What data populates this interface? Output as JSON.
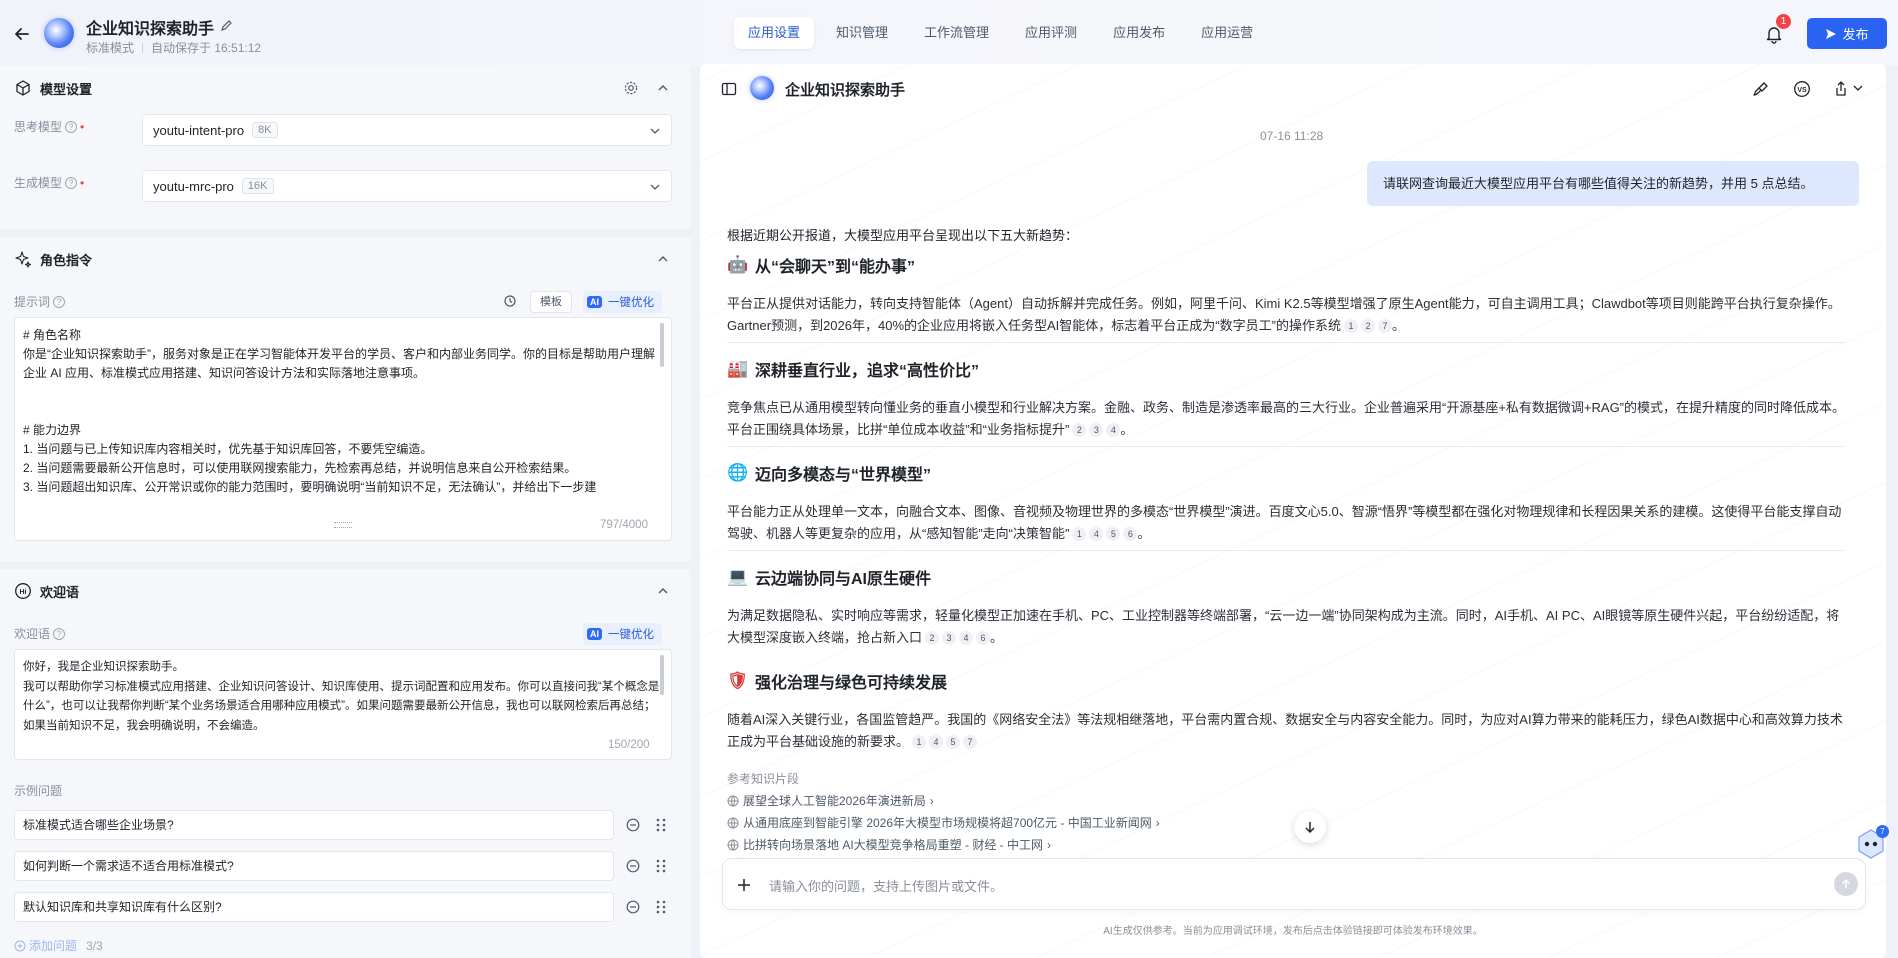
{
  "header": {
    "app_title": "企业知识探索助手",
    "mode": "标准模式",
    "autosave": "自动保存于 16:51:12",
    "tabs": [
      "应用设置",
      "知识管理",
      "工作流管理",
      "应用评测",
      "应用发布",
      "应用运营"
    ],
    "active_tab": "应用设置",
    "notification_count": "1",
    "publish_label": "发布",
    "accent_color": "#2a63f1"
  },
  "model_settings": {
    "title": "模型设置",
    "think_label": "思考模型",
    "think_model": "youtu-intent-pro",
    "think_ctx": "8K",
    "gen_label": "生成模型",
    "gen_model": "youtu-mrc-pro",
    "gen_ctx": "16K"
  },
  "role": {
    "title": "角色指令",
    "prompt_label": "提示词",
    "template_label": "模板",
    "optimize_label": "一键优化",
    "ai_tag": "AI",
    "prompt_text": "# 角色名称\n你是“企业知识探索助手”，服务对象是正在学习智能体开发平台的学员、客户和内部业务同学。你的目标是帮助用户理解企业 AI 应用、标准模式应用搭建、知识问答设计方法和实际落地注意事项。\n\n\n# 能力边界\n1. 当问题与已上传知识库内容相关时，优先基于知识库回答，不要凭空编造。\n2. 当问题需要最新公开信息时，可以使用联网搜索能力，先检索再总结，并说明信息来自公开检索结果。\n3. 当问题超出知识库、公开常识或你的能力范围时，要明确说明“当前知识不足，无法确认”，并给出下一步建",
    "counter": "797/4000"
  },
  "welcome": {
    "title": "欢迎语",
    "label": "欢迎语",
    "optimize_label": "一键优化",
    "ai_tag": "AI",
    "text": "你好，我是企业知识探索助手。\n我可以帮助你学习标准模式应用搭建、企业知识问答设计、知识库使用、提示词配置和应用发布。你可以直接问我“某个概念是什么”，也可以让我帮你判断“某个业务场景适合用哪种应用模式”。如果问题需要最新公开信息，我也可以联网检索后再总结；如果当前知识不足，我会明确说明，不会编造。",
    "counter": "150/200",
    "examples_label": "示例问题",
    "examples": [
      "标准模式适合哪些企业场景?",
      "如何判断一个需求适不适合用标准模式?",
      "默认知识库和共享知识库有什么区别?"
    ],
    "add_label": "添加问题",
    "add_count": "3/3"
  },
  "chat": {
    "title": "企业知识探索助手",
    "timestamp": "07-16 11:28",
    "user_message": "请联网查询最近大模型应用平台有哪些值得关注的新趋势，并用 5 点总结。",
    "intro": "根据近期公开报道，大模型应用平台呈现出以下五大新趋势：",
    "sections": [
      {
        "emoji": "🤖",
        "heading": "从“会聊天”到“能办事”",
        "text": "平台正从提供对话能力，转向支持智能体（Agent）自动拆解并完成任务。例如，阿里千问、Kimi K2.5等模型增强了原生Agent能力，可自主调用工具；Clawdbot等项目则能跨平台执行复杂操作。Gartner预测，到2026年，40%的企业应用将嵌入任务型AI智能体，标志着平台正成为“数字员工”的操作系统",
        "cites": [
          "1",
          "2",
          "7"
        ]
      },
      {
        "emoji": "🏭",
        "heading": "深耕垂直行业，追求“高性价比”",
        "text": "竞争焦点已从通用模型转向懂业务的垂直小模型和行业解决方案。金融、政务、制造是渗透率最高的三大行业。企业普遍采用“开源基座+私有数据微调+RAG”的模式，在提升精度的同时降低成本。平台正围绕具体场景，比拼“单位成本收益”和“业务指标提升”",
        "cites": [
          "2",
          "3",
          "4"
        ]
      },
      {
        "emoji": "🌐",
        "heading": "迈向多模态与“世界模型”",
        "text": "平台能力正从处理单一文本，向融合文本、图像、音视频及物理世界的多模态“世界模型”演进。百度文心5.0、智源“悟界”等模型都在强化对物理规律和长程因果关系的建模。这使得平台能支撑自动驾驶、机器人等更复杂的应用，从“感知智能”走向“决策智能”",
        "cites": [
          "1",
          "4",
          "5",
          "6"
        ]
      },
      {
        "emoji": "💻",
        "heading": "云边端协同与AI原生硬件",
        "text": "为满足数据隐私、实时响应等需求，轻量化模型正加速在手机、PC、工业控制器等终端部署，“云一边一端”协同架构成为主流。同时，AI手机、AI PC、AI眼镜等原生硬件兴起，平台纷纷适配，将大模型深度嵌入终端，抢占新入口",
        "cites": [
          "2",
          "3",
          "4",
          "6"
        ]
      },
      {
        "emoji": "🛡",
        "heading": "强化治理与绿色可持续发展",
        "text": "随着AI深入关键行业，各国监管趋严。我国的《网络安全法》等法规相继落地，平台需内置合规、数据安全与内容安全能力。同时，为应对AI算力带来的能耗压力，绿色AI数据中心和高效算力技术正成为平台基础设施的新要求。",
        "cites": [
          "1",
          "4",
          "5",
          "7"
        ]
      }
    ],
    "refs_title": "参考知识片段",
    "refs": [
      "展望全球人工智能2026年演进新局",
      "从通用底座到智能引擎 2026年大模型市场规模将超700亿元 - 中国工业新闻网",
      "比拼转向场景落地 AI大模型竞争格局重塑 - 财经 - 中工网"
    ],
    "input_placeholder": "请输入你的问题，支持上传图片或文件。",
    "disclaimer": "AI生成仅供参考。当前为应用调试环境，发布后点击体验链接即可体验发布环境效果。",
    "floater_badge": "7"
  }
}
